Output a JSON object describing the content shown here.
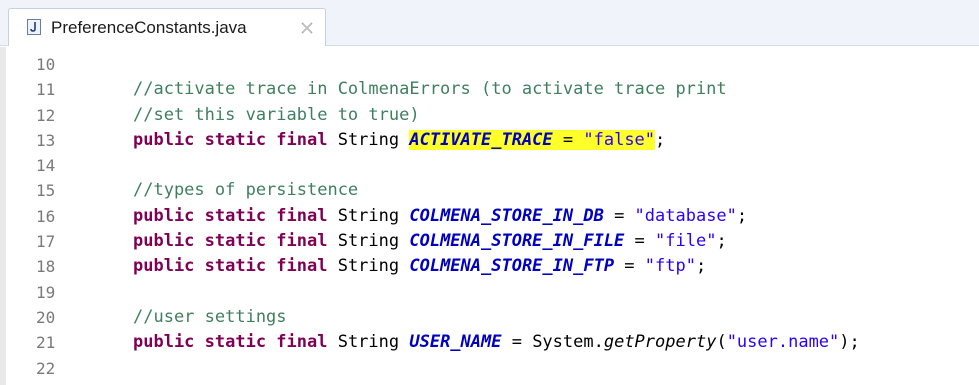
{
  "tab": {
    "filename": "PreferenceConstants.java",
    "file_icon": "java-file-icon",
    "close_icon": "close-icon"
  },
  "colors": {
    "keyword": "#7f0055",
    "comment": "#3f7f5f",
    "string": "#2a00ff",
    "field": "#0000c0",
    "highlight": "#ffff2a",
    "line_number": "#7a7a7a"
  },
  "lines": [
    {
      "number": "10",
      "tokens": []
    },
    {
      "number": "11",
      "tokens": [
        {
          "type": "comment",
          "text": "//activate trace in ColmenaErrors (to activate trace print"
        }
      ]
    },
    {
      "number": "12",
      "tokens": [
        {
          "type": "comment",
          "text": "//set this variable to true)"
        }
      ]
    },
    {
      "number": "13",
      "tokens": [
        {
          "type": "keyword",
          "text": "public static final"
        },
        {
          "type": "plain",
          "text": " String "
        },
        {
          "type": "field",
          "text": "ACTIVATE_TRACE",
          "highlight": true
        },
        {
          "type": "plain",
          "text": " = ",
          "highlight": true
        },
        {
          "type": "string",
          "text": "\"false\"",
          "highlight": true
        },
        {
          "type": "plain",
          "text": ";"
        }
      ]
    },
    {
      "number": "14",
      "tokens": []
    },
    {
      "number": "15",
      "tokens": [
        {
          "type": "comment",
          "text": "//types of persistence"
        }
      ]
    },
    {
      "number": "16",
      "tokens": [
        {
          "type": "keyword",
          "text": "public static final"
        },
        {
          "type": "plain",
          "text": " String "
        },
        {
          "type": "field",
          "text": "COLMENA_STORE_IN_DB"
        },
        {
          "type": "plain",
          "text": " = "
        },
        {
          "type": "string",
          "text": "\"database\""
        },
        {
          "type": "plain",
          "text": ";"
        }
      ]
    },
    {
      "number": "17",
      "tokens": [
        {
          "type": "keyword",
          "text": "public static final"
        },
        {
          "type": "plain",
          "text": " String "
        },
        {
          "type": "field",
          "text": "COLMENA_STORE_IN_FILE"
        },
        {
          "type": "plain",
          "text": " = "
        },
        {
          "type": "string",
          "text": "\"file\""
        },
        {
          "type": "plain",
          "text": ";"
        }
      ]
    },
    {
      "number": "18",
      "tokens": [
        {
          "type": "keyword",
          "text": "public static final"
        },
        {
          "type": "plain",
          "text": " String "
        },
        {
          "type": "field",
          "text": "COLMENA_STORE_IN_FTP"
        },
        {
          "type": "plain",
          "text": " = "
        },
        {
          "type": "string",
          "text": "\"ftp\""
        },
        {
          "type": "plain",
          "text": ";"
        }
      ]
    },
    {
      "number": "19",
      "tokens": []
    },
    {
      "number": "20",
      "tokens": [
        {
          "type": "comment",
          "text": "//user settings"
        }
      ]
    },
    {
      "number": "21",
      "tokens": [
        {
          "type": "keyword",
          "text": "public static final"
        },
        {
          "type": "plain",
          "text": " String "
        },
        {
          "type": "field",
          "text": "USER_NAME"
        },
        {
          "type": "plain",
          "text": " = System."
        },
        {
          "type": "method",
          "text": "getProperty"
        },
        {
          "type": "plain",
          "text": "("
        },
        {
          "type": "string",
          "text": "\"user.name\""
        },
        {
          "type": "plain",
          "text": ");"
        }
      ]
    },
    {
      "number": "22",
      "tokens": []
    }
  ]
}
